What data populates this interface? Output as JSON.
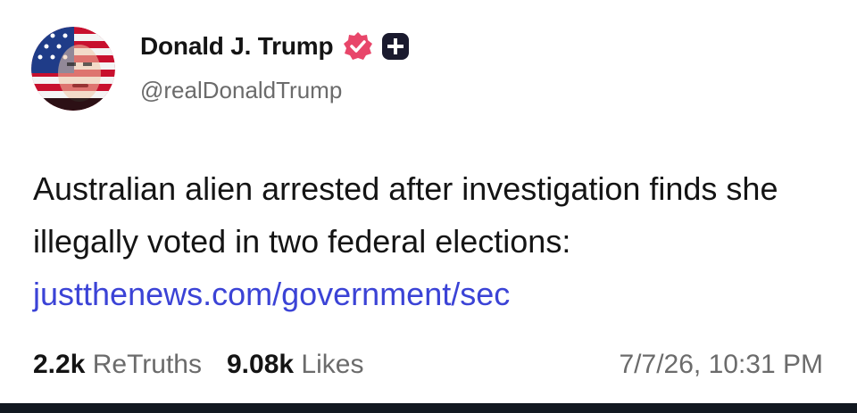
{
  "author": {
    "name": "Donald J. Trump",
    "handle": "@realDonaldTrump"
  },
  "post": {
    "text": "Australian alien arrested after investigation finds she illegally voted in two federal elections: ",
    "link": "justthenews.com/government/sec"
  },
  "stats": {
    "retruths_count": "2.2k",
    "retruths_label": "ReTruths",
    "likes_count": "9.08k",
    "likes_label": "Likes",
    "timestamp": "7/7/26, 10:31 PM"
  },
  "icons": {
    "verified": "verified-badge-icon",
    "plus": "plus-badge-icon"
  },
  "colors": {
    "link": "#3b43d6",
    "verified": "#e8466a",
    "plus_badge": "#1a1a2e",
    "bottom_bar": "#121820"
  }
}
